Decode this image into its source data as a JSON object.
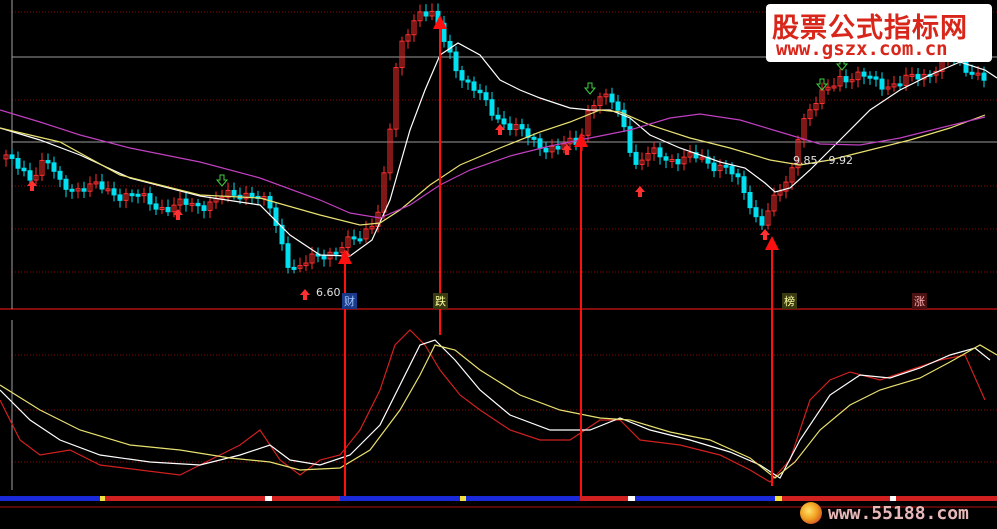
{
  "watermark": {
    "title": "股票公式指标网",
    "url": "www.gszx.com.cn",
    "bottom_url": "www.55188.com"
  },
  "colors": {
    "background": "#000000",
    "up_candle": "#ff3030",
    "down_candle": "#00e0f0",
    "ma_fast": "#ffffff",
    "ma_mid": "#e8e070",
    "ma_slow": "#c040c0",
    "osc_fast": "#d02020",
    "osc_mid": "#ffffff",
    "osc_slow": "#e8e070",
    "signal_arrow": "#ff1010",
    "grid": "#8b0000"
  },
  "chart_data": [
    {
      "type": "candlestick",
      "panel": "price",
      "annotations": {
        "low_label": "6.60",
        "range_label": "9.85 - 9.92"
      },
      "signal_labels": [
        {
          "text": "财",
          "color": "#a0c8ff"
        },
        {
          "text": "跌",
          "color": "#ffffa0"
        },
        {
          "text": "榜",
          "color": "#ffffa0"
        },
        {
          "text": "涨",
          "color": "#ffb0b0"
        }
      ],
      "buy_markers": 8,
      "sell_markers": 4,
      "grid": true
    },
    {
      "type": "line",
      "panel": "oscillator",
      "series_count": 3,
      "grid": true,
      "signal_arrows": 4
    }
  ]
}
